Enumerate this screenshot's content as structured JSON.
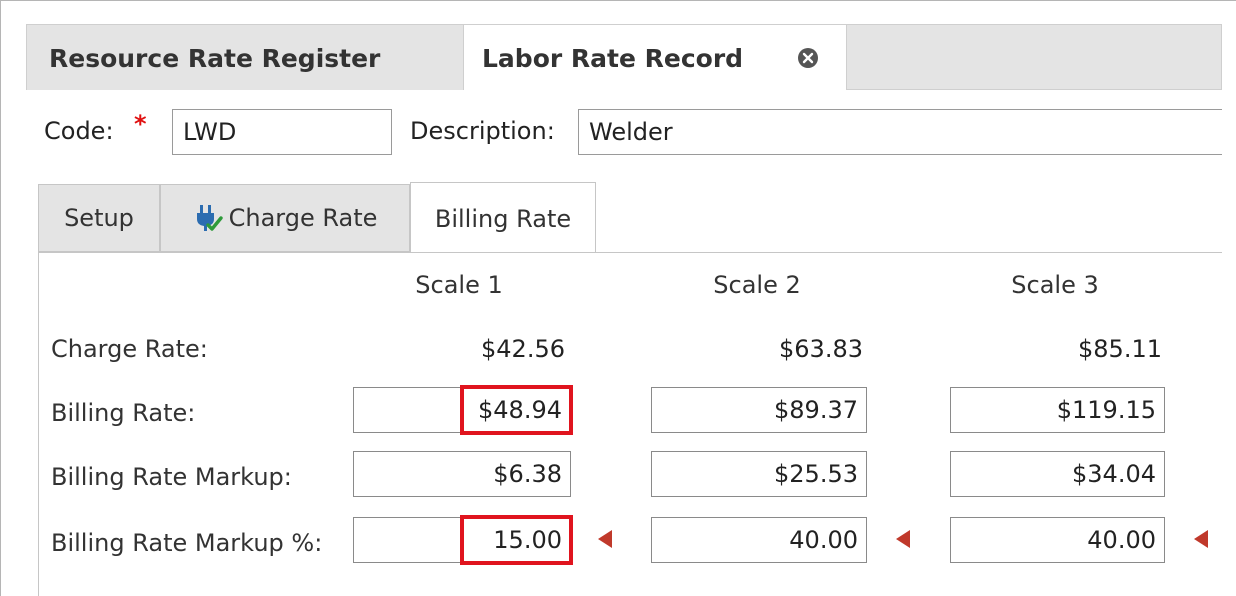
{
  "document_tabs": [
    {
      "label": "Resource Rate Register"
    },
    {
      "label": "Labor Rate Record"
    }
  ],
  "header": {
    "code_label": "Code:",
    "required_marker": "*",
    "code_value": "LWD",
    "description_label": "Description:",
    "description_value": "Welder"
  },
  "subtabs": [
    {
      "label": "Setup"
    },
    {
      "label": "Charge Rate",
      "icon": "plug-check-icon"
    },
    {
      "label": "Billing Rate"
    }
  ],
  "billing": {
    "columns": [
      "Scale 1",
      "Scale 2",
      "Scale 3"
    ],
    "rows": {
      "charge_rate": {
        "label": "Charge Rate:",
        "values": [
          "$42.56",
          "$63.83",
          "$85.11"
        ]
      },
      "billing_rate": {
        "label": "Billing Rate:",
        "values": [
          "$48.94",
          "$89.37",
          "$119.15"
        ]
      },
      "markup": {
        "label": "Billing Rate Markup:",
        "values": [
          "$6.38",
          "$25.53",
          "$34.04"
        ]
      },
      "markup_pct": {
        "label": "Billing Rate Markup %:",
        "values": [
          "15.00",
          "40.00",
          "40.00"
        ]
      }
    }
  },
  "colors": {
    "highlight": "#e0141e",
    "arrow": "#c0392b",
    "required": "#e01010"
  }
}
